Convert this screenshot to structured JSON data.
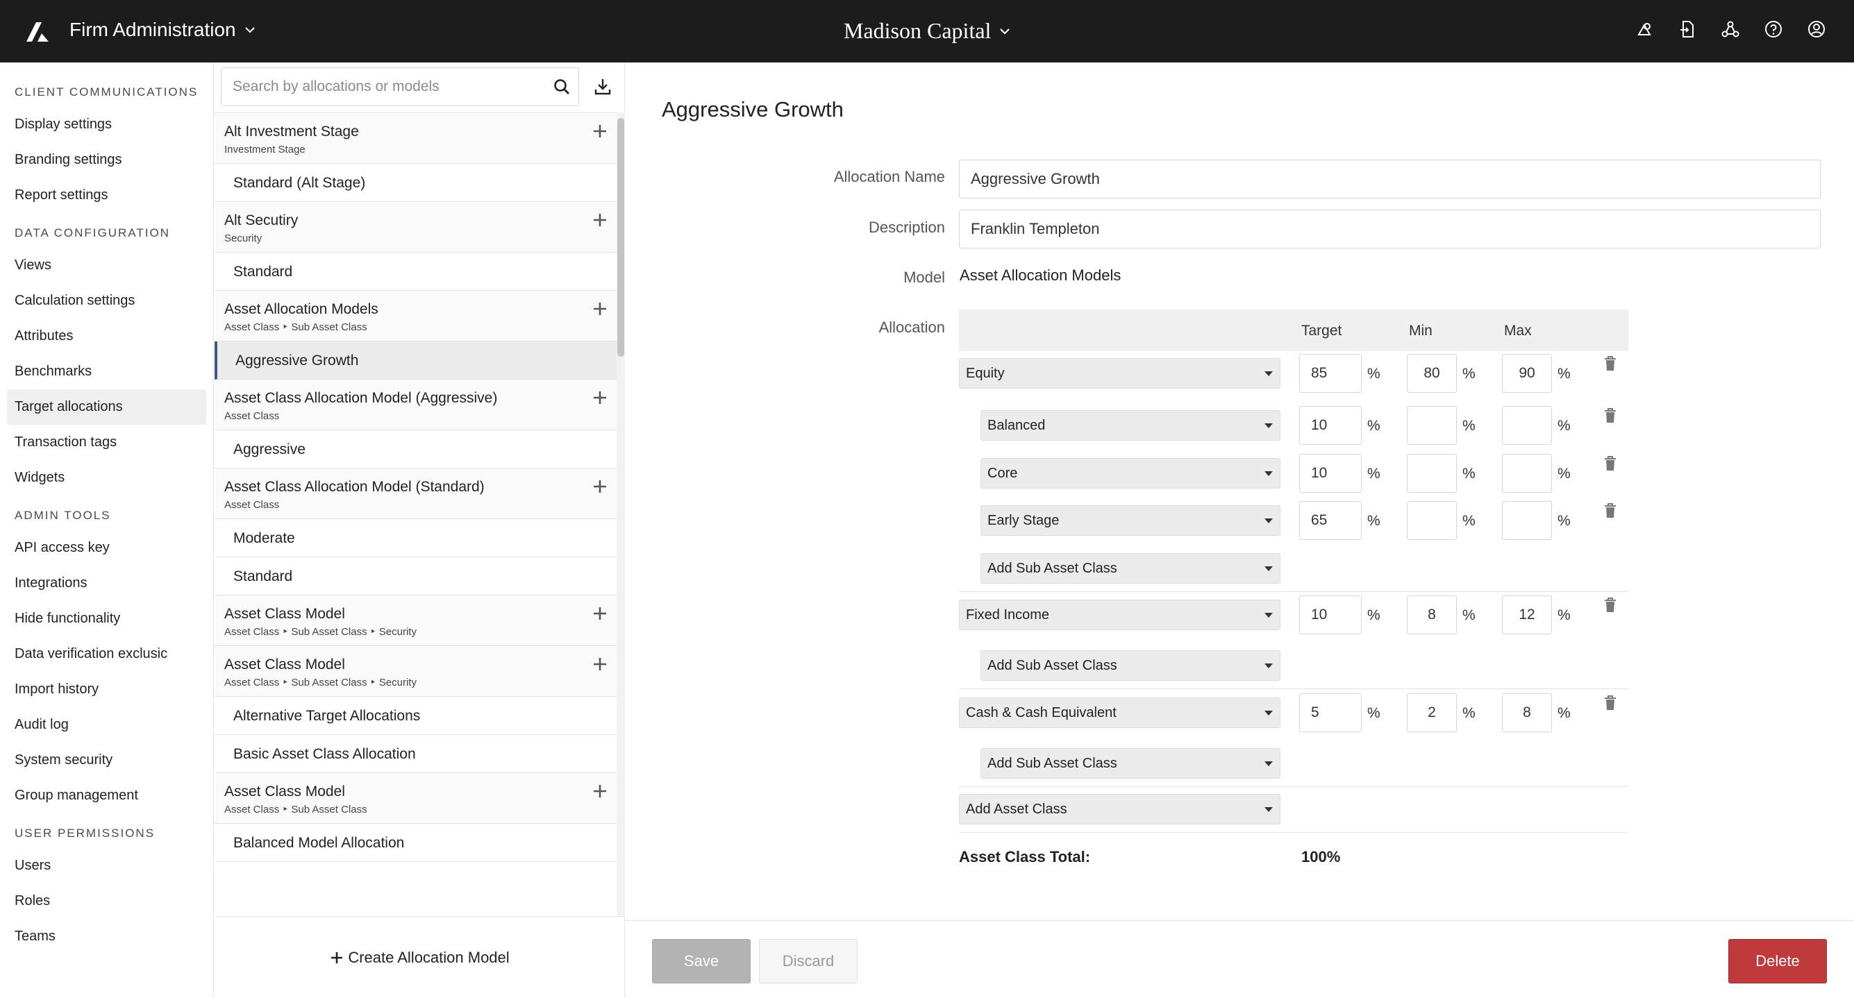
{
  "topbar": {
    "app_title": "Firm Administration",
    "client_name": "Madison Capital",
    "icons": [
      "shapes-icon",
      "document-import-icon",
      "network-icon",
      "help-icon",
      "user-icon"
    ]
  },
  "sidebar": {
    "sections": [
      {
        "heading": "CLIENT COMMUNICATIONS",
        "items": [
          "Display settings",
          "Branding settings",
          "Report settings"
        ]
      },
      {
        "heading": "DATA CONFIGURATION",
        "items": [
          "Views",
          "Calculation settings",
          "Attributes",
          "Benchmarks",
          "Target allocations",
          "Transaction tags",
          "Widgets"
        ]
      },
      {
        "heading": "ADMIN TOOLS",
        "items": [
          "API access key",
          "Integrations",
          "Hide functionality",
          "Data verification exclusic",
          "Import history",
          "Audit log",
          "System security",
          "Group management"
        ]
      },
      {
        "heading": "USER PERMISSIONS",
        "items": [
          "Users",
          "Roles",
          "Teams"
        ]
      }
    ],
    "active_item": "Target allocations"
  },
  "middle": {
    "search_placeholder": "Search by allocations or models",
    "groups": [
      {
        "title": "Alt Investment Stage",
        "subtitle": "Investment Stage",
        "items": [
          "Standard (Alt Stage)"
        ]
      },
      {
        "title": "Alt Secutiry",
        "subtitle": "Security",
        "items": [
          "Standard"
        ]
      },
      {
        "title": "Asset Allocation Models",
        "subtitle": "Asset Class ‣ Sub Asset Class",
        "items": [
          "Aggressive Growth"
        ]
      },
      {
        "title": "Asset Class Allocation Model (Aggressive)",
        "subtitle": "Asset Class",
        "items": [
          "Aggressive"
        ]
      },
      {
        "title": "Asset Class Allocation Model (Standard)",
        "subtitle": "Asset Class",
        "items": [
          "Moderate",
          "Standard"
        ]
      },
      {
        "title": "Asset Class Model",
        "subtitle": "Asset Class ‣ Sub Asset Class ‣ Security",
        "items": []
      },
      {
        "title": "Asset Class Model",
        "subtitle": "Asset Class ‣ Sub Asset Class ‣ Security",
        "items": [
          "Alternative Target Allocations",
          "Basic Asset Class Allocation"
        ]
      },
      {
        "title": "Asset Class Model",
        "subtitle": "Asset Class ‣ Sub Asset Class",
        "items": [
          "Balanced Model Allocation"
        ]
      }
    ],
    "selected_item": "Aggressive Growth",
    "create_label": "Create Allocation Model"
  },
  "main": {
    "title": "Aggressive Growth",
    "labels": {
      "name": "Allocation Name",
      "description": "Description",
      "model": "Model",
      "allocation": "Allocation"
    },
    "allocation_name": "Aggressive Growth",
    "description": "Franklin Templeton",
    "model": "Asset Allocation Models",
    "columns": {
      "target": "Target",
      "min": "Min",
      "max": "Max"
    },
    "pct": "%",
    "add_sub": "Add Sub Asset Class",
    "add_class": "Add Asset Class",
    "rows": [
      {
        "name": "Equity",
        "target": "85",
        "min": "80",
        "max": "90"
      },
      {
        "name": "Balanced",
        "target": "10",
        "min": "",
        "max": ""
      },
      {
        "name": "Core",
        "target": "10",
        "min": "",
        "max": ""
      },
      {
        "name": "Early Stage",
        "target": "65",
        "min": "",
        "max": ""
      },
      {
        "name": "Fixed Income",
        "target": "10",
        "min": "8",
        "max": "12"
      },
      {
        "name": "Cash & Cash Equivalent",
        "target": "5",
        "min": "2",
        "max": "8"
      }
    ],
    "total_label": "Asset Class Total:",
    "total_value": "100%"
  },
  "footer": {
    "save": "Save",
    "discard": "Discard",
    "delete": "Delete"
  }
}
